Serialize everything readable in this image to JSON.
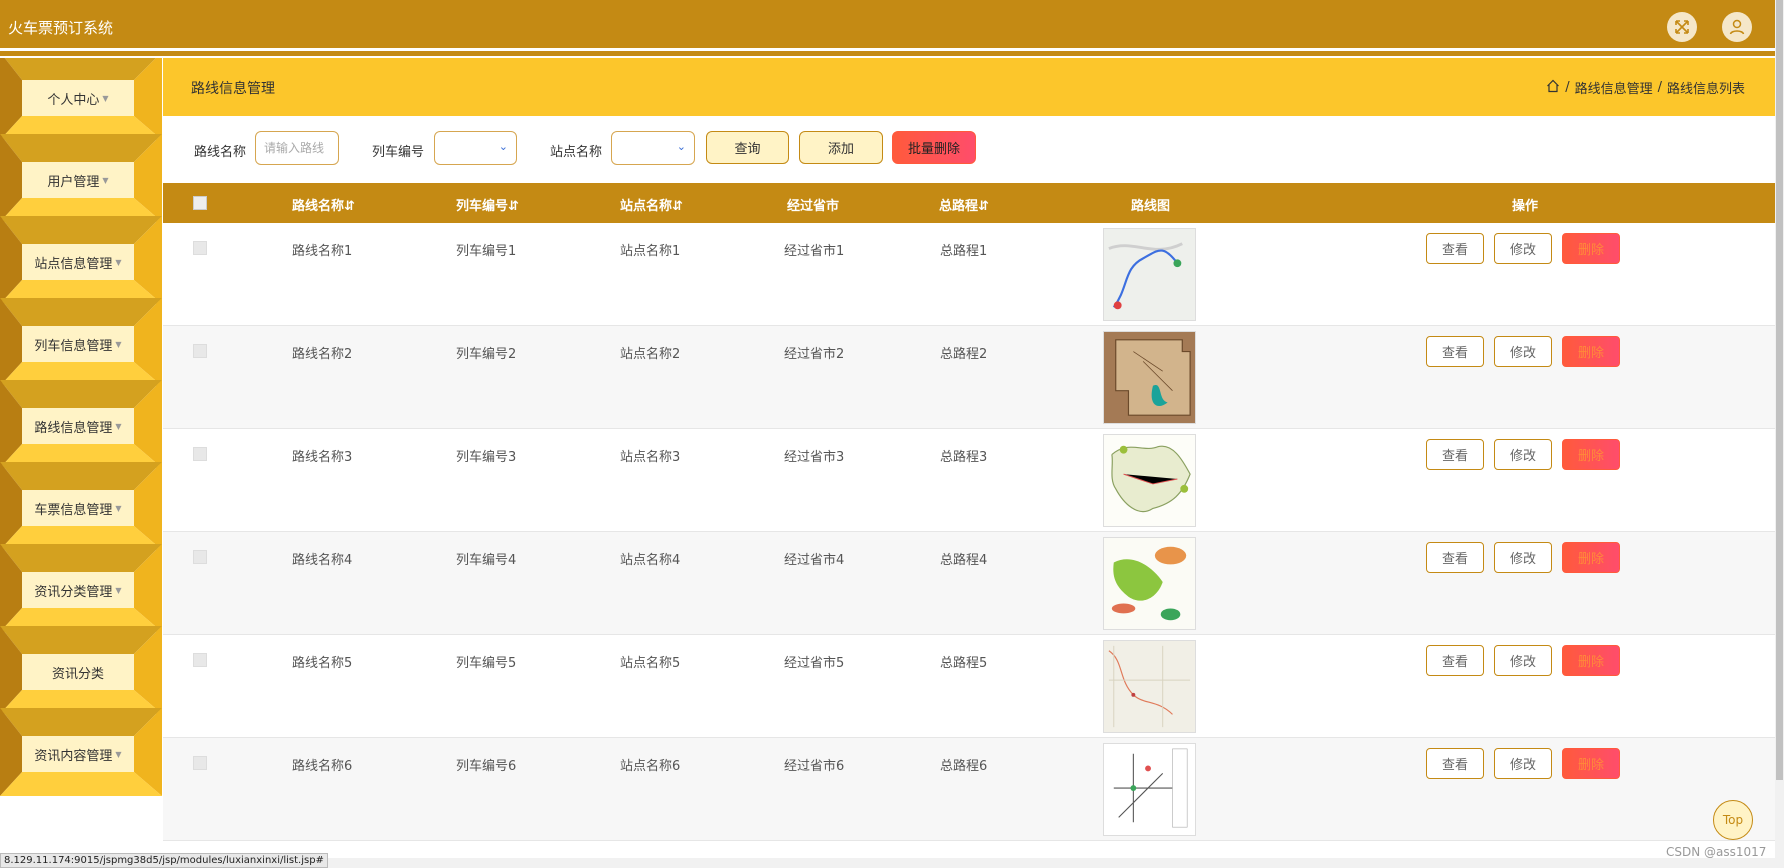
{
  "app": {
    "title": "火车票预订系统"
  },
  "header_icons": [
    "fullscreen-icon",
    "user-icon"
  ],
  "sidebar": {
    "items": [
      {
        "label": "个人中心",
        "has_caret": true
      },
      {
        "label": "用户管理",
        "has_caret": true
      },
      {
        "label": "站点信息管理",
        "has_caret": true
      },
      {
        "label": "列车信息管理",
        "has_caret": true
      },
      {
        "label": "路线信息管理",
        "has_caret": true
      },
      {
        "label": "车票信息管理",
        "has_caret": true
      },
      {
        "label": "资讯分类管理",
        "has_caret": true
      },
      {
        "label": "资讯分类",
        "has_caret": false
      },
      {
        "label": "资讯内容管理",
        "has_caret": true
      }
    ]
  },
  "page": {
    "title": "路线信息管理",
    "breadcrumb": [
      "路线信息管理",
      "路线信息列表"
    ]
  },
  "search": {
    "route_label": "路线名称",
    "route_placeholder": "请输入路线",
    "train_label": "列车编号",
    "station_label": "站点名称",
    "query_button": "查询",
    "add_button": "添加",
    "batch_delete_button": "批量删除"
  },
  "table": {
    "headers": [
      "路线名称",
      "列车编号",
      "站点名称",
      "经过省市",
      "总路程",
      "路线图",
      "操作"
    ],
    "rows": [
      {
        "route": "路线名称1",
        "train": "列车编号1",
        "station": "站点名称1",
        "provinces": "经过省市1",
        "distance": "总路程1"
      },
      {
        "route": "路线名称2",
        "train": "列车编号2",
        "station": "站点名称2",
        "provinces": "经过省市2",
        "distance": "总路程2"
      },
      {
        "route": "路线名称3",
        "train": "列车编号3",
        "station": "站点名称3",
        "provinces": "经过省市3",
        "distance": "总路程3"
      },
      {
        "route": "路线名称4",
        "train": "列车编号4",
        "station": "站点名称4",
        "provinces": "经过省市4",
        "distance": "总路程4"
      },
      {
        "route": "路线名称5",
        "train": "列车编号5",
        "station": "站点名称5",
        "provinces": "经过省市5",
        "distance": "总路程5"
      },
      {
        "route": "路线名称6",
        "train": "列车编号6",
        "station": "站点名称6",
        "provinces": "经过省市6",
        "distance": "总路程6"
      }
    ],
    "actions": {
      "view": "查看",
      "edit": "修改",
      "delete": "删除"
    }
  },
  "back_to_top": "Top",
  "status_url": "8.129.11.174:9015/jspmg38d5/jsp/modules/luxianxinxi/list.jsp#",
  "watermark": "CSDN @ass1017",
  "colors": {
    "primary": "#c48a14",
    "accent": "#fcc62b",
    "button_bg": "#fff3c6",
    "danger": "#ff5a3c"
  }
}
